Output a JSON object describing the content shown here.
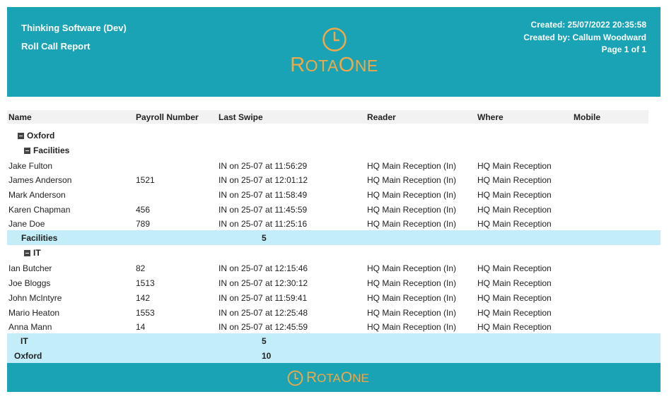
{
  "header": {
    "company": "Thinking Software (Dev)",
    "report_title": "Roll Call Report",
    "created": "Created: 25/07/2022 20:35:58",
    "created_by": "Created by: Callum Woodward",
    "page": "Page 1 of  1",
    "logo_text": "RotaOne",
    "logo_color": "#f0a848",
    "band_color": "#19a3b5"
  },
  "columns": [
    "Name",
    "Payroll Number",
    "Last Swipe",
    "Reader",
    "Where",
    "Mobile"
  ],
  "site": {
    "name": "Oxford",
    "total_label": "Oxford",
    "total": "10"
  },
  "groups": [
    {
      "name": "Facilities",
      "total_label": "Facilities",
      "total": "5",
      "rows": [
        {
          "name": "Jake Fulton",
          "payroll": "",
          "swipe": "IN on 25-07 at 11:56:29",
          "reader": "HQ Main Reception (In)",
          "where": "HQ Main Reception"
        },
        {
          "name": "James Anderson",
          "payroll": "1521",
          "swipe": "IN on 25-07 at 12:01:12",
          "reader": "HQ Main Reception (In)",
          "where": "HQ Main Reception"
        },
        {
          "name": "Mark Anderson",
          "payroll": "",
          "swipe": "IN on 25-07 at 11:58:49",
          "reader": "HQ Main Reception (In)",
          "where": "HQ Main Reception"
        },
        {
          "name": "Karen Chapman",
          "payroll": "456",
          "swipe": "IN on 25-07 at 11:45:59",
          "reader": "HQ Main Reception (In)",
          "where": "HQ Main Reception"
        },
        {
          "name": "Jane Doe",
          "payroll": "789",
          "swipe": "IN on 25-07 at 11:25:16",
          "reader": "HQ Main Reception (In)",
          "where": "HQ Main Reception"
        }
      ]
    },
    {
      "name": "IT",
      "total_label": "IT",
      "total": "5",
      "rows": [
        {
          "name": "Ian Butcher",
          "payroll": "82",
          "swipe": "IN on 25-07 at 12:15:46",
          "reader": "HQ Main Reception (In)",
          "where": "HQ Main Reception"
        },
        {
          "name": "Joe Bloggs",
          "payroll": "1513",
          "swipe": "IN on 25-07 at 12:30:12",
          "reader": "HQ Main Reception (In)",
          "where": "HQ Main Reception"
        },
        {
          "name": "John McIntyre",
          "payroll": "142",
          "swipe": "IN on 25-07 at 11:59:41",
          "reader": "HQ Main Reception (In)",
          "where": "HQ Main Reception"
        },
        {
          "name": "Mario Heaton",
          "payroll": "1553",
          "swipe": "IN on 25-07 at 12:25:48",
          "reader": "HQ Main Reception (In)",
          "where": "HQ Main Reception"
        },
        {
          "name": "Anna Mann",
          "payroll": "14",
          "swipe": "IN on 25-07 at 12:45:59",
          "reader": "HQ Main Reception (In)",
          "where": "HQ Main Reception"
        }
      ]
    }
  ]
}
